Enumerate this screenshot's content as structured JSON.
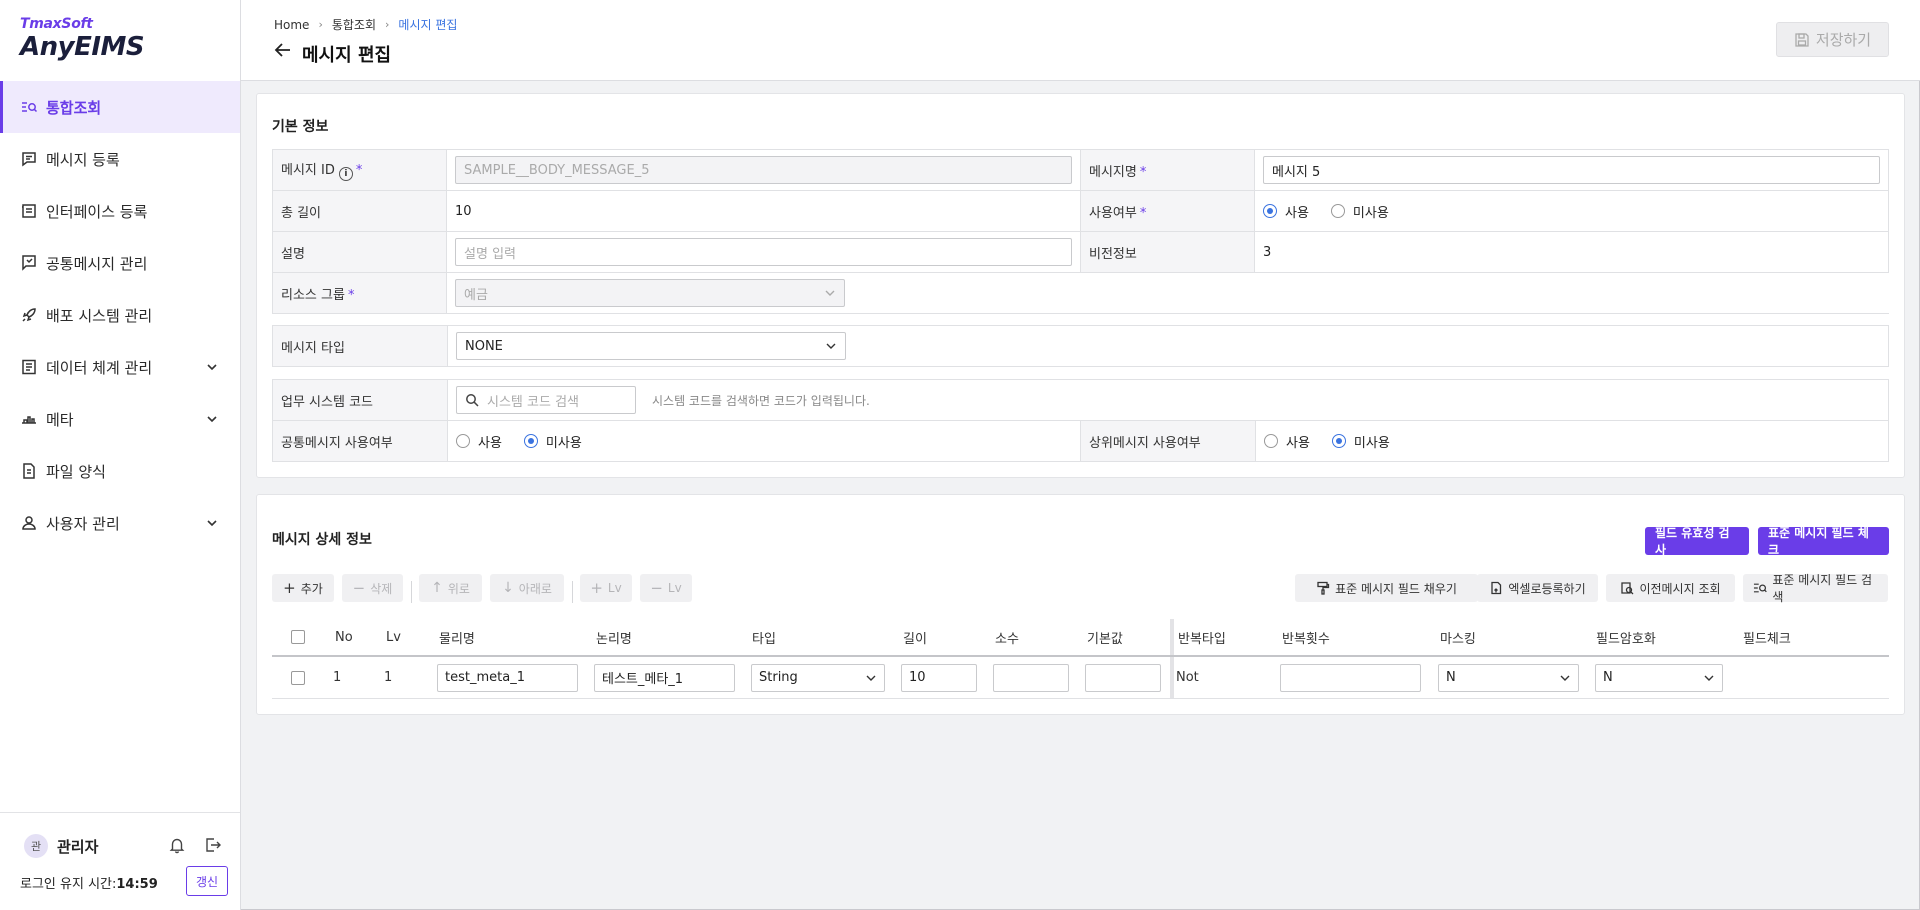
{
  "brand": {
    "top": "TmaxSoft",
    "main": "AnyEIMS"
  },
  "sidebar": {
    "items": [
      {
        "label": "통합조회",
        "icon": "search-list-icon",
        "active": true,
        "expandable": false
      },
      {
        "label": "메시지 등록",
        "icon": "message-icon",
        "active": false,
        "expandable": false
      },
      {
        "label": "인터페이스 등록",
        "icon": "interface-icon",
        "active": false,
        "expandable": false
      },
      {
        "label": "공통메시지 관리",
        "icon": "common-message-icon",
        "active": false,
        "expandable": false
      },
      {
        "label": "배포 시스템 관리",
        "icon": "rocket-icon",
        "active": false,
        "expandable": false
      },
      {
        "label": "데이터 체계 관리",
        "icon": "document-icon",
        "active": false,
        "expandable": true
      },
      {
        "label": "메타",
        "icon": "meta-icon",
        "active": false,
        "expandable": true
      },
      {
        "label": "파일 양식",
        "icon": "file-icon",
        "active": false,
        "expandable": false
      },
      {
        "label": "사용자 관리",
        "icon": "user-icon",
        "active": false,
        "expandable": true
      }
    ],
    "footer": {
      "avatar_text": "관",
      "user_name": "관리자",
      "session_label": "로그인 유지 시간:",
      "session_time": "14:59",
      "refresh_label": "갱신"
    }
  },
  "header": {
    "breadcrumb": [
      "Home",
      "통합조회",
      "메시지 편집"
    ],
    "title": "메시지 편집",
    "save_label": "저장하기"
  },
  "basic_info": {
    "title": "기본 정보",
    "message_id": {
      "label": "메시지 ID",
      "placeholder": "SAMPLE__BODY_MESSAGE_5"
    },
    "message_name": {
      "label": "메시지명",
      "value": "메시지 5"
    },
    "total_length": {
      "label": "총 길이",
      "value": "10"
    },
    "usage": {
      "label": "사용여부",
      "options": [
        "사용",
        "미사용"
      ],
      "selected": "사용"
    },
    "description": {
      "label": "설명",
      "placeholder": "설명 입력"
    },
    "version": {
      "label": "비전정보",
      "value": "3"
    },
    "resource_group": {
      "label": "리소스 그룹",
      "value": "예금"
    },
    "message_type": {
      "label": "메시지 타입",
      "value": "NONE"
    },
    "system_code": {
      "label": "업무 시스템 코드",
      "placeholder": "시스템 코드 검색",
      "hint": "시스템 코드를 검색하면 코드가 입력됩니다."
    },
    "common_usage": {
      "label": "공통메시지 사용여부",
      "options": [
        "사용",
        "미사용"
      ],
      "selected": "미사용"
    },
    "parent_usage": {
      "label": "상위메시지 사용여부",
      "options": [
        "사용",
        "미사용"
      ],
      "selected": "미사용"
    }
  },
  "detail": {
    "title": "메시지 상세 정보",
    "validate_btn": "필드 유효성 검사",
    "std_check_btn": "표준 메시지 필드 체크",
    "toolbar": {
      "add": "추가",
      "delete": "삭제",
      "up": "위로",
      "down": "아래로",
      "lv_plus": "Lv",
      "lv_minus": "Lv",
      "fill_std": "표준 메시지 필드 채우기",
      "excel": "엑셀로등록하기",
      "prev_msg": "이전메시지 조회",
      "search_std": "표준 메시지 필드 검색"
    },
    "columns": [
      "No",
      "Lv",
      "물리명",
      "논리명",
      "타입",
      "길이",
      "소수",
      "기본값",
      "반복타입",
      "반복횟수",
      "마스킹",
      "필드암호화",
      "필드체크"
    ],
    "rows": [
      {
        "no": "1",
        "lv": "1",
        "physical": "test_meta_1",
        "logical": "테스트_메타_1",
        "type": "String",
        "length": "10",
        "decimal": "",
        "default": "",
        "repeat_type": "Not",
        "repeat_count": "",
        "masking": "N",
        "encryption": "N",
        "check": ""
      }
    ]
  }
}
